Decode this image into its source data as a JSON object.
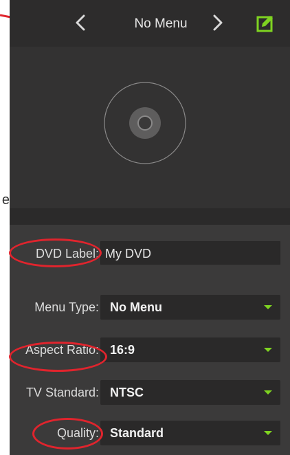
{
  "header": {
    "title": "No Menu",
    "prev_icon": "chevron-left-icon",
    "next_icon": "chevron-right-icon",
    "edit_icon": "edit-icon"
  },
  "left_edge_text": "e",
  "form": {
    "dvd_label": {
      "label": "DVD Label:",
      "value": "My DVD"
    },
    "menu_type": {
      "label": "Menu Type:",
      "value": "No Menu"
    },
    "aspect_ratio": {
      "label": "Aspect Ratio:",
      "value": "16:9"
    },
    "tv_standard": {
      "label": "TV Standard:",
      "value": "NTSC"
    },
    "quality": {
      "label": "Quality:",
      "value": "Standard"
    }
  },
  "colors": {
    "accent": "#7ed321",
    "annotation": "#e0242d",
    "panel": "#3b3a3a",
    "header": "#2d2c2c"
  }
}
